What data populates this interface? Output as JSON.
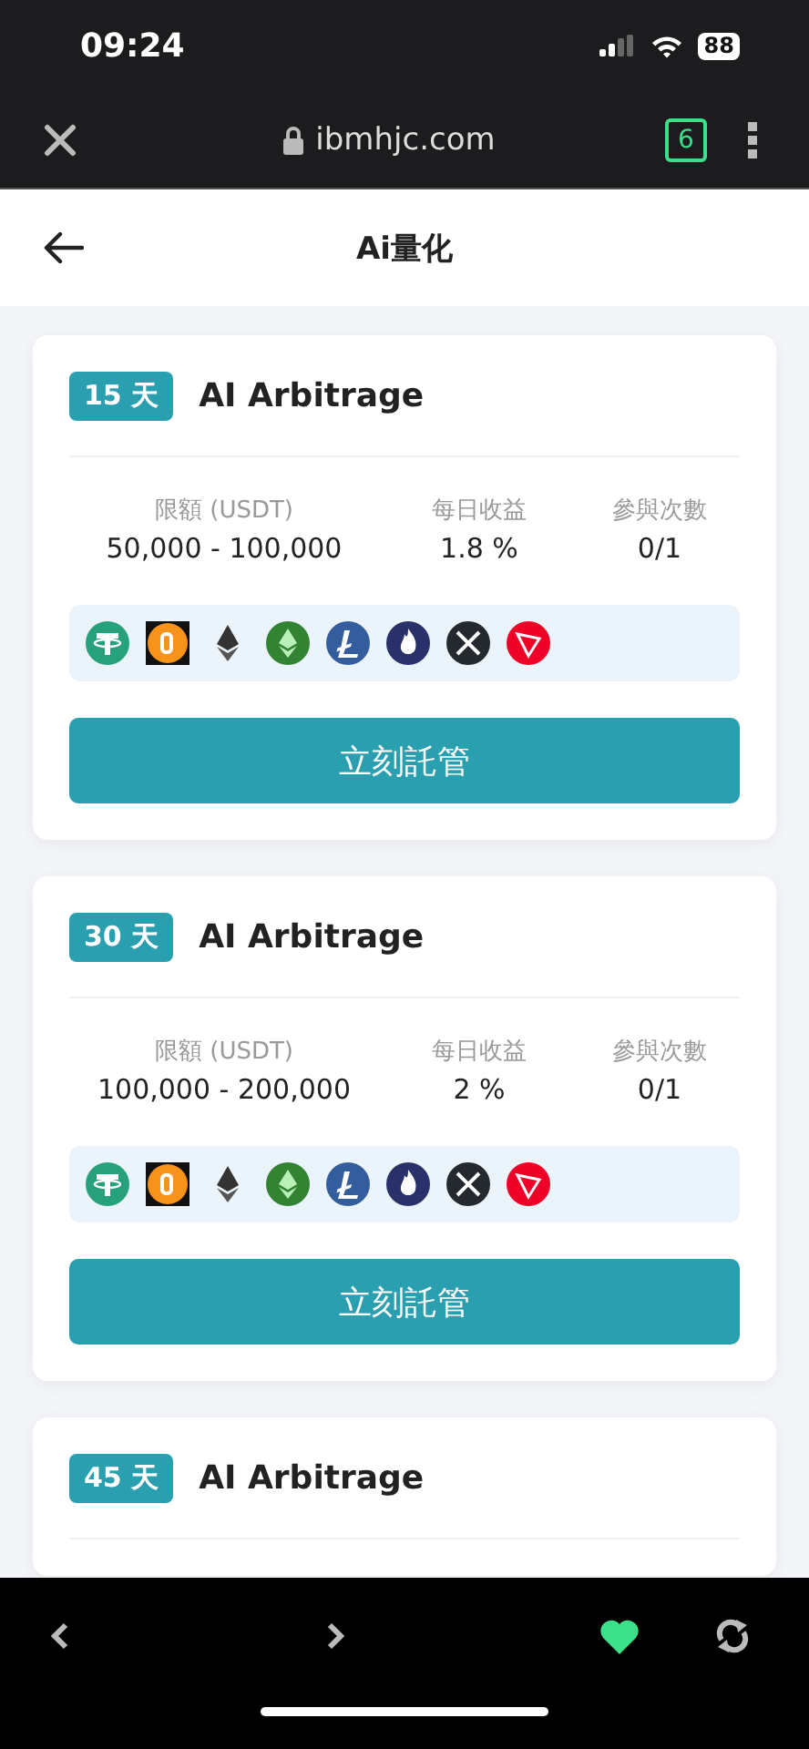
{
  "status_bar": {
    "time": "09:24",
    "battery": "88"
  },
  "browser_bar": {
    "domain": "ibmhjc.com",
    "tab_count": "6"
  },
  "header": {
    "title": "Ai量化"
  },
  "cards": [
    {
      "days": "15 天",
      "title": "AI Arbitrage",
      "stats": [
        {
          "label": "限額 (USDT)",
          "value": "50,000 - 100,000"
        },
        {
          "label": "每日收益",
          "value": "1.8 %"
        },
        {
          "label": "參與次數",
          "value": "0/1"
        }
      ],
      "button": "立刻託管"
    },
    {
      "days": "30 天",
      "title": "AI Arbitrage",
      "stats": [
        {
          "label": "限額 (USDT)",
          "value": "100,000 - 200,000"
        },
        {
          "label": "每日收益",
          "value": "2 %"
        },
        {
          "label": "參與次數",
          "value": "0/1"
        }
      ],
      "button": "立刻託管"
    },
    {
      "days": "45 天",
      "title": "AI Arbitrage"
    }
  ]
}
